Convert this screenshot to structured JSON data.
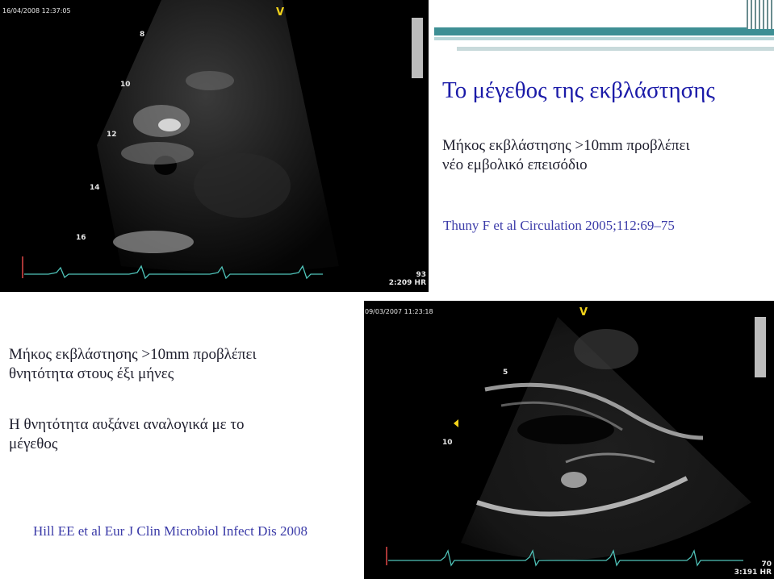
{
  "slide": {
    "title": "Το μέγεθος της εκβλάστησης",
    "point_top": {
      "line1": "Μήκος εκβλάστησης >10mm προβλέπει",
      "line2": "νέο εμβολικό επεισόδιο"
    },
    "ref_top": "Thuny F et al Circulation 2005;112:69–75",
    "point_left_1": {
      "line1": "Μήκος εκβλάστησης >10mm προβλέπει",
      "line2": "θνητότητα στους έξι μήνες"
    },
    "point_left_2": {
      "line1": "Η θνητότητα αυξάνει αναλογικά με το",
      "line2": "μέγεθος"
    },
    "ref_bottom": "Hill EE et al  Eur J Clin Microbiol Infect  Dis 2008"
  },
  "echo_top": {
    "timestamp": "16/04/2008 12:37:05",
    "orientation_marker": "V",
    "depth_labels": [
      "8",
      "10",
      "12",
      "14",
      "16"
    ],
    "frame": "2:209",
    "heart_rate": "93",
    "hr_unit": "HR"
  },
  "echo_bottom": {
    "timestamp": "09/03/2007 11:23:18",
    "orientation_marker": "V",
    "depth_labels": [
      "5",
      "10"
    ],
    "frame": "3:191",
    "heart_rate": "70",
    "hr_unit": "HR"
  },
  "colors": {
    "title": "#1a1aa8",
    "reference": "#3b3ba8",
    "accent_teal": "#3e8f94",
    "ecg_trace": "#4fc3b9"
  }
}
